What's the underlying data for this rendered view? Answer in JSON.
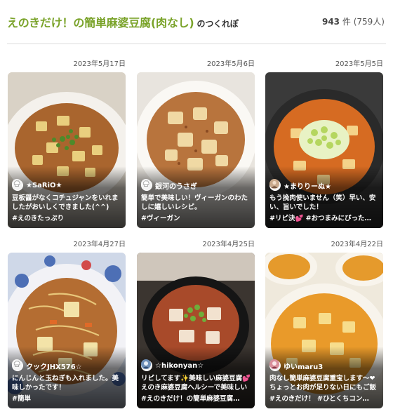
{
  "header": {
    "title": "えのきだけ！の簡単麻婆豆腐(肉なし)",
    "title_suffix": "のつくれぽ",
    "count": "943",
    "count_unit": "件",
    "count_extra": "(759人)"
  },
  "reports": [
    {
      "date": "2023年5月17日",
      "author": "★SaRiO★",
      "comment": "豆板醤がなくコチュジャンをいれましたがおいしくできました(^^)",
      "tags": "#えのきたっぷり",
      "avatar_icon": "chef-hat-icon"
    },
    {
      "date": "2023年5月6日",
      "author": "銀河のうさぎ",
      "comment": "簡単で美味しい！ヴィーガンのわたしに嬉しいレシピ。",
      "tags": "#ヴィーガン",
      "avatar_icon": "chef-hat-icon"
    },
    {
      "date": "2023年5月5日",
      "author": "★まりりーぬ★",
      "comment": "もう挽肉使いません（笑）早い、安い、旨いでした！",
      "tags": "#リピ決💕 #おつまみにぴった…",
      "avatar_icon": "user-photo-icon"
    },
    {
      "date": "2023年4月27日",
      "author": "クックJHX576☆",
      "comment": "にんじんと玉ねぎも入れました。美味しかったです！",
      "tags": "#簡単",
      "avatar_icon": "chef-hat-icon"
    },
    {
      "date": "2023年4月25日",
      "author": "☆hikonyan☆",
      "comment": "リピしてます✨美味しい麻婆豆腐💕えのき麻婆豆腐ヘルシーで美味しい✨ご飯と一緒に美味しく頂…",
      "tags": "#えのきだけ！の簡単麻婆豆腐…",
      "avatar_icon": "user-photo-icon"
    },
    {
      "date": "2023年4月22日",
      "author": "ゆいmaru3",
      "comment": "肉なし簡単麻婆豆腐重宝します〜❤ちょっとお肉が足りない日にもご飯が進む系おかず、男子たち…",
      "tags": "#えのきだけ！ #ひとくちコン…",
      "avatar_icon": "user-photo-icon"
    }
  ],
  "colors": {
    "title_green": "#7aa32a",
    "text": "#333333",
    "divider": "#dddddd"
  }
}
